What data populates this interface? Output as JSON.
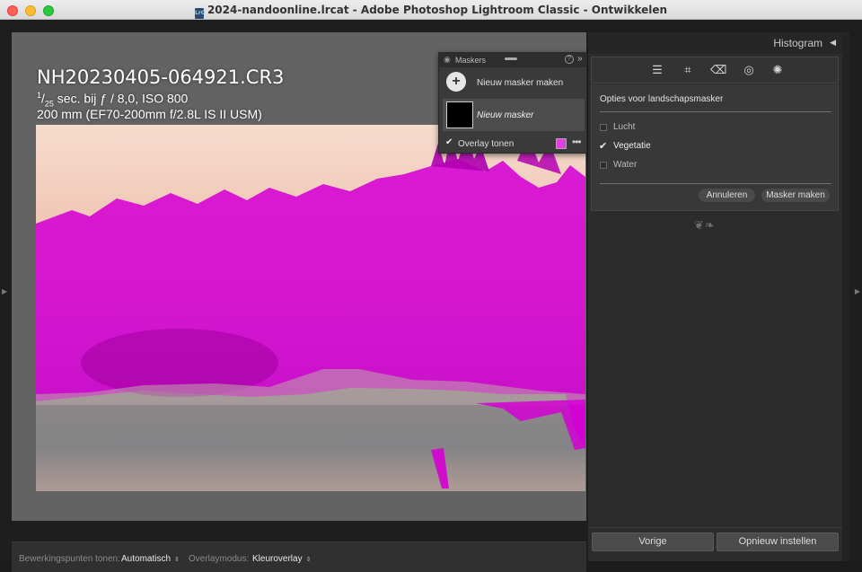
{
  "window": {
    "title": "2024-nandoonline.lrcat - Adobe Photoshop Lightroom Classic - Ontwikkelen",
    "file_icon_text": "LrC"
  },
  "photo_info": {
    "filename": "NH20230405-064921.CR3",
    "exposure_numerator": "1",
    "exposure_denominator": "25",
    "exposure_rest": " sec. bij ƒ / 8,0, ISO 800",
    "lens": "200 mm (EF70-200mm f/2.8L IS II USM)"
  },
  "bottom_toolbar": {
    "show_points_label": "Bewerkingspunten tonen:",
    "show_points_value": "Automatisch",
    "overlay_mode_label": "Overlaymodus:",
    "overlay_mode_value": "Kleuroverlay"
  },
  "masks_panel": {
    "title": "Maskers",
    "help": "?",
    "collapse": "»",
    "new_mask_label": "Nieuw masker maken",
    "mask_name": "Nieuw masker",
    "overlay_label": "Overlay tonen",
    "overlay_checked": true,
    "overlay_color": "#e040e0",
    "more": "•••"
  },
  "right_panel": {
    "histogram_label": "Histogram",
    "histogram_arrow": "◀",
    "tools": [
      "sliders-icon",
      "crop-icon",
      "healing-eraser-icon",
      "red-eye-icon",
      "masking-icon"
    ],
    "landscape_options_title": "Opties voor landschapsmasker",
    "options": [
      {
        "label": "Lucht",
        "checked": false
      },
      {
        "label": "Vegetatie",
        "checked": true
      },
      {
        "label": "Water",
        "checked": false
      }
    ],
    "cancel_label": "Annuleren",
    "create_mask_label": "Masker maken",
    "previous_label": "Vorige",
    "reset_label": "Opnieuw instellen"
  },
  "colors": {
    "mask_overlay": "#d400d4"
  }
}
